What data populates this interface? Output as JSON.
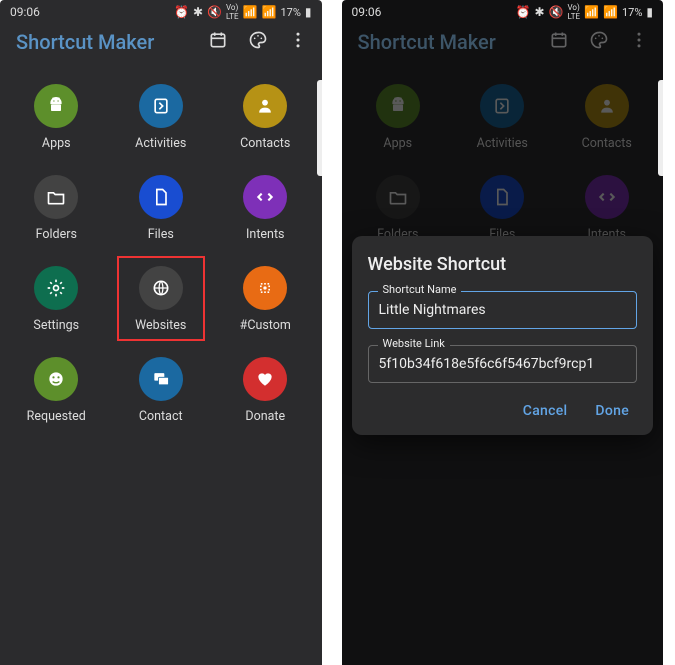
{
  "status": {
    "time": "09:06",
    "battery": "17%"
  },
  "app": {
    "title": "Shortcut Maker"
  },
  "items": [
    {
      "label": "Apps",
      "color": "#5d8f2b",
      "icon": "android"
    },
    {
      "label": "Activities",
      "color": "#1b69a1",
      "icon": "activity"
    },
    {
      "label": "Contacts",
      "color": "#b69215",
      "icon": "contacts"
    },
    {
      "label": "Folders",
      "color": "#434343",
      "icon": "folder"
    },
    {
      "label": "Files",
      "color": "#194dd1",
      "icon": "file"
    },
    {
      "label": "Intents",
      "color": "#7e30b8",
      "icon": "code"
    },
    {
      "label": "Settings",
      "color": "#0e6e4f",
      "icon": "gear"
    },
    {
      "label": "Websites",
      "color": "#434343",
      "icon": "globe",
      "highlight": true
    },
    {
      "label": "#Custom",
      "color": "#e86b14",
      "icon": "custom"
    },
    {
      "label": "Requested",
      "color": "#5d8f2b",
      "icon": "requested"
    },
    {
      "label": "Contact",
      "color": "#1b69a1",
      "icon": "chat"
    },
    {
      "label": "Donate",
      "color": "#d32f2f",
      "icon": "heart"
    }
  ],
  "dialog": {
    "title": "Website Shortcut",
    "field1_legend": "Shortcut Name",
    "field1_value": "Little Nightmares",
    "field2_legend": "Website Link",
    "field2_value": "5f10b34f618e5f6c6f5467bcf9rcp1",
    "cancel": "Cancel",
    "done": "Done"
  }
}
